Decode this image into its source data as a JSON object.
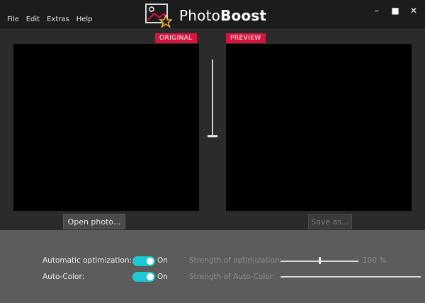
{
  "menu": [
    "File",
    "Edit",
    "Extras",
    "Help"
  ],
  "brand": {
    "name_light": "Photo",
    "name_bold": "Boost"
  },
  "window_controls": {
    "minimize": "–",
    "maximize": "■",
    "close": "✕"
  },
  "viewer": {
    "original_tag": "ORIGINAL",
    "preview_tag": "PREVIEW",
    "open_button": "Open photo...",
    "save_button": "Save as..."
  },
  "settings": {
    "auto_opt_label": "Automatic optimization:",
    "auto_opt_state": "On",
    "auto_color_label": "Auto-Color:",
    "auto_color_state": "On",
    "strength_opt_label": "Strength of optimization:",
    "strength_opt_value": "100 %",
    "strength_color_label": "Strength of Auto-Color:"
  },
  "colors": {
    "accent_red": "#d6153f",
    "toggle_cyan": "#1ec8d6"
  }
}
